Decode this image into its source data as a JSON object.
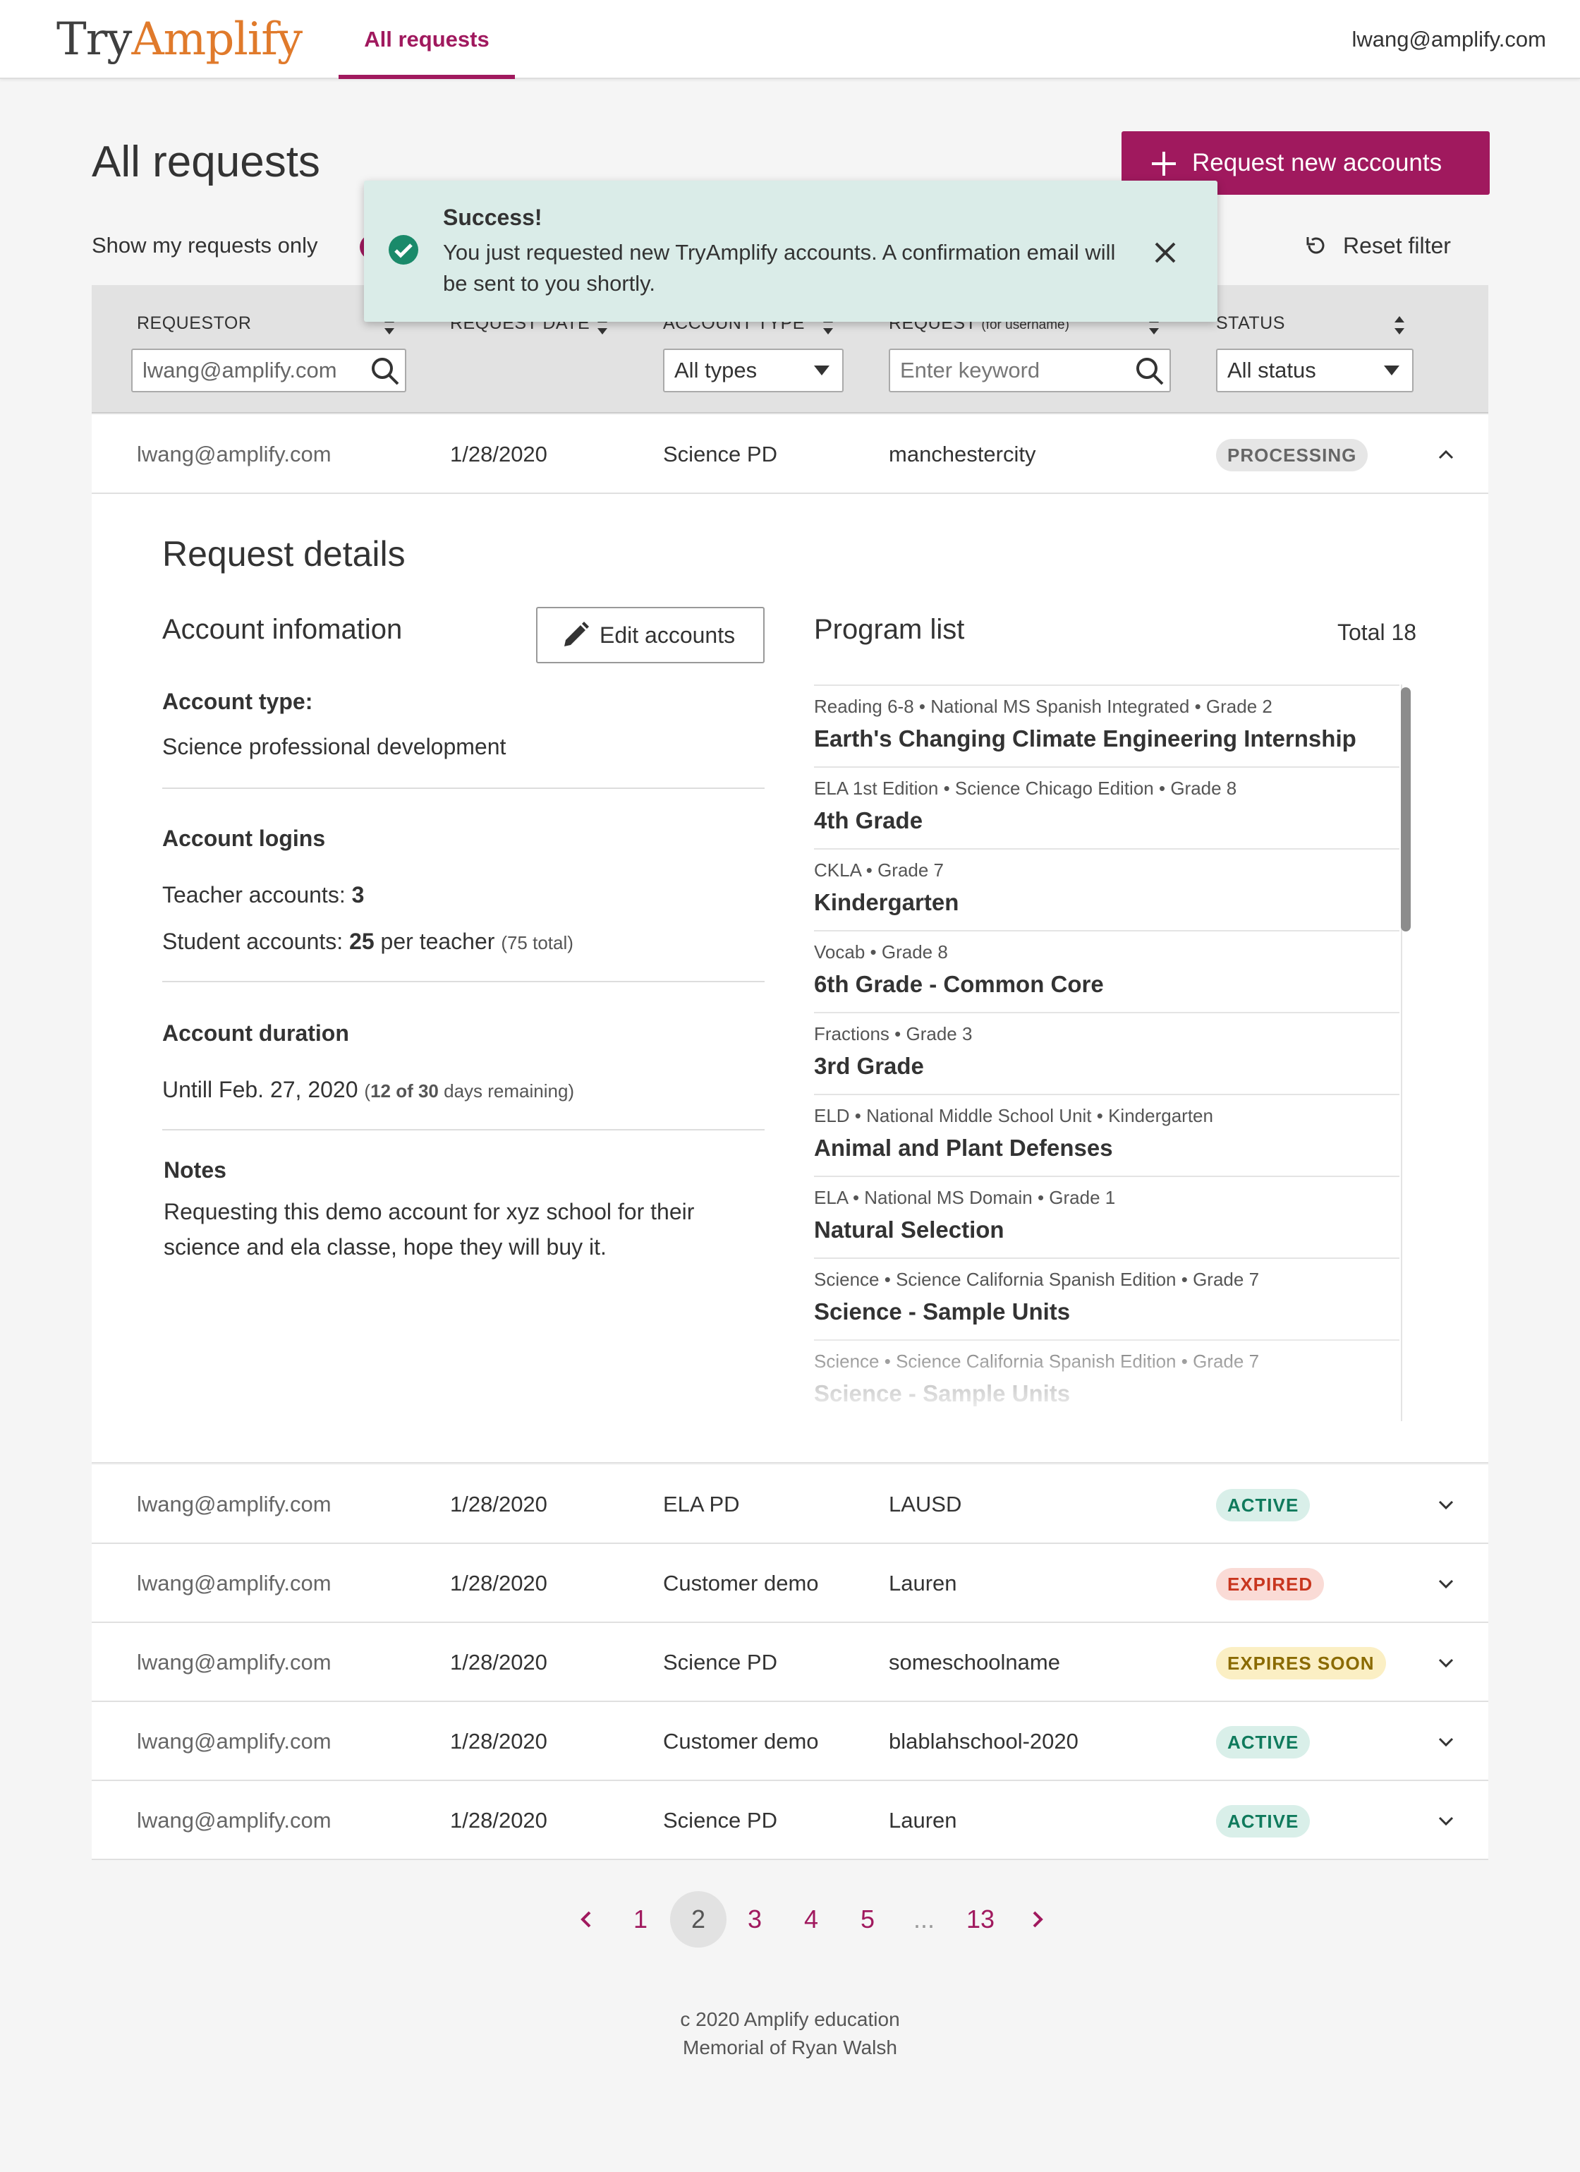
{
  "app": {
    "logo_part1": "Try",
    "logo_part2": "Amplify",
    "nav_tab": "All requests",
    "user_email": "lwang@amplify.com"
  },
  "page": {
    "title": "All requests",
    "new_button": "Request new accounts",
    "show_mine": "Show my requests only",
    "reset_filter": "Reset filter"
  },
  "toast": {
    "title": "Success!",
    "message": "You just requested new TryAmplify accounts. A confirmation email will be sent to you shortly."
  },
  "table": {
    "columns": {
      "requestor": "REQUESTOR",
      "date": "REQUEST DATE",
      "type": "ACCOUNT TYPE",
      "request": "REQUEST",
      "request_note": "(for username)",
      "status": "STATUS"
    },
    "filters": {
      "requestor_value": "lwang@amplify.com",
      "type_value": "All types",
      "keyword_placeholder": "Enter keyword",
      "status_value": "All status"
    },
    "rows": [
      {
        "requestor": "lwang@amplify.com",
        "date": "1/28/2020",
        "type": "Science PD",
        "name": "manchestercity",
        "status": "PROCESSING"
      },
      {
        "requestor": "lwang@amplify.com",
        "date": "1/28/2020",
        "type": "ELA PD",
        "name": "LAUSD",
        "status": "ACTIVE"
      },
      {
        "requestor": "lwang@amplify.com",
        "date": "1/28/2020",
        "type": "Customer demo",
        "name": "Lauren",
        "status": "EXPIRED"
      },
      {
        "requestor": "lwang@amplify.com",
        "date": "1/28/2020",
        "type": "Science PD",
        "name": "someschoolname",
        "status": "EXPIRES SOON"
      },
      {
        "requestor": "lwang@amplify.com",
        "date": "1/28/2020",
        "type": "Customer demo",
        "name": "blablahschool-2020",
        "status": "ACTIVE"
      },
      {
        "requestor": "lwang@amplify.com",
        "date": "1/28/2020",
        "type": "Science PD",
        "name": "Lauren",
        "status": "ACTIVE"
      }
    ]
  },
  "details": {
    "title": "Request details",
    "account_heading": "Account infomation",
    "edit_button": "Edit accounts",
    "type_label": "Account type:",
    "type_value": "Science professional development",
    "logins_label": "Account logins",
    "teacher_prefix": "Teacher accounts: ",
    "teacher_count": "3",
    "student_prefix": "Student accounts: ",
    "student_count": "25",
    "student_suffix": " per teacher",
    "student_total": "(75 total)",
    "duration_label": "Account duration",
    "duration_value": "Untill Feb. 27, 2020",
    "duration_remaining_open": "(",
    "duration_remaining_num": "12 of 30",
    "duration_remaining_text": " days remaining)",
    "notes_label": "Notes",
    "notes_text": "Requesting this demo account for xyz school for their science and ela classe, hope they will buy it.",
    "program_heading": "Program list",
    "program_total": "Total 18",
    "programs": [
      {
        "meta": [
          "Reading 6-8",
          "National MS Spanish Integrated",
          "Grade 2"
        ],
        "name": "Earth's Changing Climate Engineering Internship"
      },
      {
        "meta": [
          "ELA 1st Edition",
          "Science Chicago Edition",
          "Grade 8"
        ],
        "name": "4th Grade"
      },
      {
        "meta": [
          "CKLA",
          "Grade 7"
        ],
        "name": "Kindergarten"
      },
      {
        "meta": [
          "Vocab",
          "Grade 8"
        ],
        "name": "6th Grade - Common Core"
      },
      {
        "meta": [
          "Fractions",
          "Grade 3"
        ],
        "name": "3rd Grade"
      },
      {
        "meta": [
          "ELD",
          "National Middle School Unit",
          "Kindergarten"
        ],
        "name": "Animal and Plant Defenses"
      },
      {
        "meta": [
          "ELA",
          "National MS Domain",
          "Grade 1"
        ],
        "name": "Natural Selection"
      },
      {
        "meta": [
          "Science",
          "Science California Spanish Edition",
          "Grade 7"
        ],
        "name": "Science - Sample Units"
      },
      {
        "meta": [
          "Science",
          "Science California Spanish Edition",
          "Grade 7"
        ],
        "name": "Science - Sample Units"
      }
    ]
  },
  "pagination": {
    "pages": [
      "1",
      "2",
      "3",
      "4",
      "5",
      "...",
      "13"
    ],
    "current": "2"
  },
  "footer": {
    "line1": "c 2020 Amplify education",
    "line2": "Memorial of Ryan Walsh"
  },
  "colors": {
    "brand": "#a0195e",
    "logo_accent": "#e07a2b",
    "success": "#1a8a6a"
  }
}
